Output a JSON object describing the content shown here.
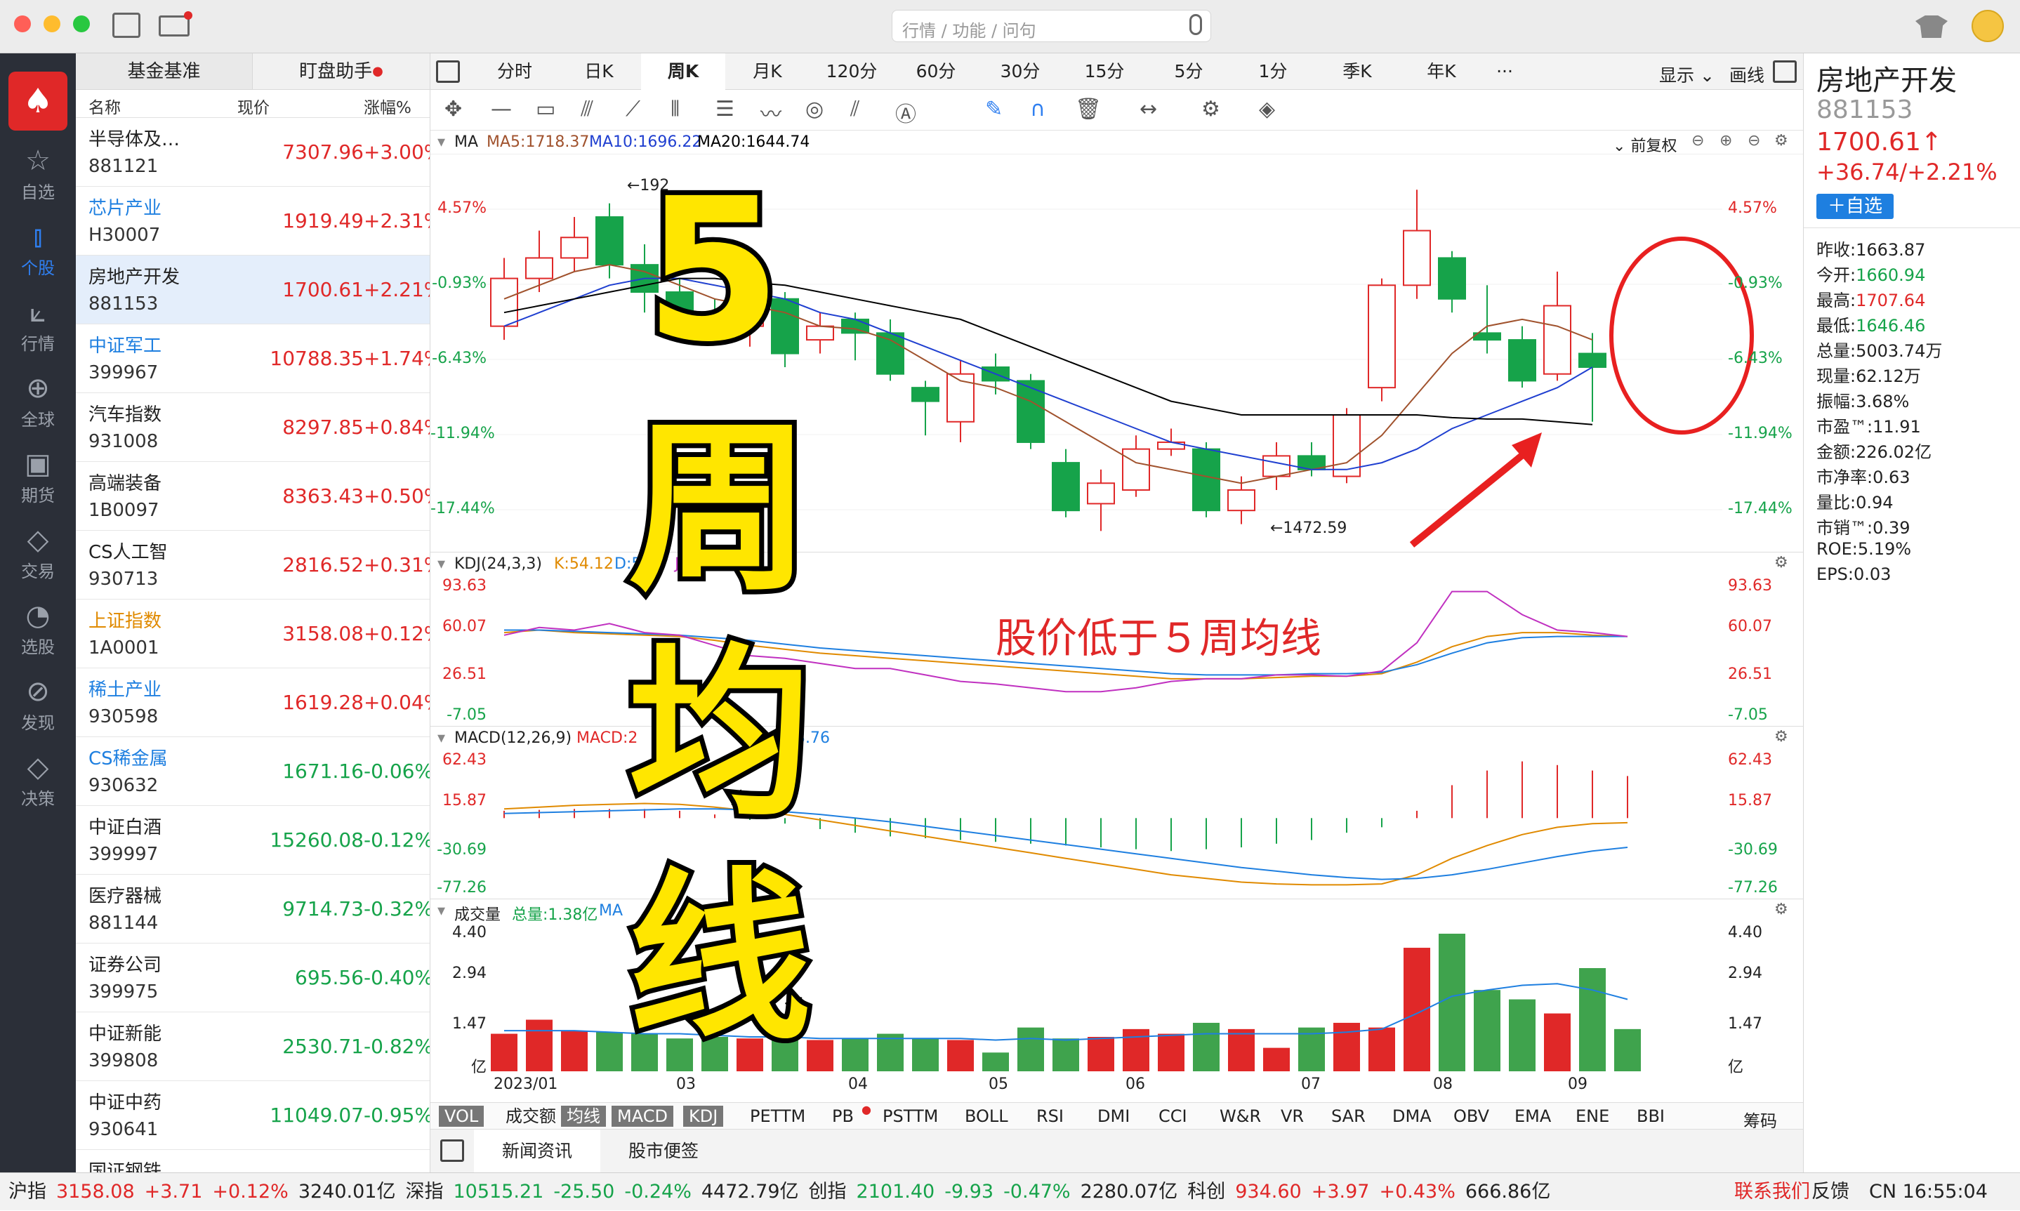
{
  "search": {
    "placeholder": "行情 / 功能 / 问句"
  },
  "nav": [
    {
      "icon": "star-icon",
      "label": "自选"
    },
    {
      "icon": "stock-icon",
      "label": "个股"
    },
    {
      "icon": "chart-icon",
      "label": "行情"
    },
    {
      "icon": "globe-icon",
      "label": "全球"
    },
    {
      "icon": "futures-icon",
      "label": "期货"
    },
    {
      "icon": "trade-icon",
      "label": "交易"
    },
    {
      "icon": "select-icon",
      "label": "选股"
    },
    {
      "icon": "compass-icon",
      "label": "发现"
    },
    {
      "icon": "diamond-icon",
      "label": "决策"
    }
  ],
  "watchlist": {
    "tabs": [
      "基金基准",
      "盯盘助手"
    ],
    "headers": [
      "名称",
      "现价",
      "涨幅%"
    ],
    "rows": [
      {
        "name": "半导体及…",
        "code": "881121",
        "price": "7307.96",
        "pct": "+3.00%",
        "up": true,
        "blue": false
      },
      {
        "name": "芯片产业",
        "code": "H30007",
        "price": "1919.49",
        "pct": "+2.31%",
        "up": true,
        "blue": true
      },
      {
        "name": "房地产开发",
        "code": "881153",
        "price": "1700.61",
        "pct": "+2.21%",
        "up": true,
        "blue": false
      },
      {
        "name": "中证军工",
        "code": "399967",
        "price": "10788.35",
        "pct": "+1.74%",
        "up": true,
        "blue": true
      },
      {
        "name": "汽车指数",
        "code": "931008",
        "price": "8297.85",
        "pct": "+0.84%",
        "up": true,
        "blue": false
      },
      {
        "name": "高端装备",
        "code": "1B0097",
        "price": "8363.43",
        "pct": "+0.50%",
        "up": true,
        "blue": false
      },
      {
        "name": "CS人工智",
        "code": "930713",
        "price": "2816.52",
        "pct": "+0.31%",
        "up": true,
        "blue": false
      },
      {
        "name": "上证指数",
        "code": "1A0001",
        "price": "3158.08",
        "pct": "+0.12%",
        "up": true,
        "blue": false,
        "orange": true
      },
      {
        "name": "稀土产业",
        "code": "930598",
        "price": "1619.28",
        "pct": "+0.04%",
        "up": true,
        "blue": true
      },
      {
        "name": "CS稀金属",
        "code": "930632",
        "price": "1671.16",
        "pct": "-0.06%",
        "up": false,
        "blue": true
      },
      {
        "name": "中证白酒",
        "code": "399997",
        "price": "15260.08",
        "pct": "-0.12%",
        "up": false,
        "blue": false
      },
      {
        "name": "医疗器械",
        "code": "881144",
        "price": "9714.73",
        "pct": "-0.32%",
        "up": false,
        "blue": false
      },
      {
        "name": "证券公司",
        "code": "399975",
        "price": "695.56",
        "pct": "-0.40%",
        "up": false,
        "blue": false
      },
      {
        "name": "中证新能",
        "code": "399808",
        "price": "2530.71",
        "pct": "-0.82%",
        "up": false,
        "blue": false
      },
      {
        "name": "中证中药",
        "code": "930641",
        "price": "11049.07",
        "pct": "-0.95%",
        "up": false,
        "blue": false
      },
      {
        "name": "国证钢铁",
        "code": "",
        "price": "",
        "pct": "",
        "up": false,
        "blue": false
      }
    ]
  },
  "periods": [
    "分时",
    "日K",
    "周K",
    "月K",
    "120分",
    "60分",
    "30分",
    "15分",
    "5分",
    "1分",
    "季K",
    "年K",
    "···"
  ],
  "display_label": "显示",
  "draw_label": "画线",
  "panels": {
    "ma": {
      "label": "MA",
      "ma5": "MA5:1718.37",
      "ma10": "MA10:1696.22",
      "ma20": "MA20:1644.74",
      "fq": "前复权",
      "axis": [
        "4.57%",
        "-0.93%",
        "-6.43%",
        "-11.94%",
        "-17.44%"
      ],
      "high_label": "←192",
      "low_label": "←1472.59"
    },
    "kdj": {
      "label": "KDJ(24,3,3)",
      "k": "K:54.12",
      "d": "D:5",
      "j": "J:56.74",
      "axis": [
        "93.63",
        "60.07",
        "26.51",
        "-7.05"
      ]
    },
    "macd": {
      "label": "MACD(12,26,9)",
      "macd": "MACD:2",
      "dea": "3.76",
      "axis": [
        "62.43",
        "15.87",
        "-30.69",
        "-77.26"
      ]
    },
    "vol": {
      "label": "成交量",
      "total": "总量:1.38亿",
      "ma": "MA",
      "axis": [
        "4.40",
        "2.94",
        "1.47",
        "亿"
      ],
      "dates": [
        "2023/01",
        "03",
        "04",
        "05",
        "06",
        "07",
        "08",
        "09"
      ]
    }
  },
  "indicators": [
    "VOL",
    "成交额",
    "均线",
    "MACD",
    "KDJ",
    "PETTM",
    "PB",
    "PSTTM",
    "BOLL",
    "RSI",
    "DMI",
    "CCI",
    "W&R",
    "VR",
    "SAR",
    "DMA",
    "OBV",
    "EMA",
    "ENE",
    "BBI"
  ],
  "chips_label": "筹码",
  "bottom_tabs": [
    "新闻资讯",
    "股市便签"
  ],
  "overlay": {
    "chars": [
      "5",
      "周",
      "均",
      "线"
    ],
    "annotation": "股价低于５周均线"
  },
  "quote": {
    "name": "房地产开发",
    "code": "881153",
    "price": "1700.61↑",
    "change": "+36.74/+2.21%",
    "add": "＋自选",
    "fields": [
      {
        "k": "昨收:",
        "v": "1663.87",
        "c": "n"
      },
      {
        "k": "今开:",
        "v": "1660.94",
        "c": "g"
      },
      {
        "k": "最高:",
        "v": "1707.64",
        "c": "r"
      },
      {
        "k": "最低:",
        "v": "1646.46",
        "c": "g"
      },
      {
        "k": "总量:",
        "v": "5003.74万",
        "c": "n"
      },
      {
        "k": "现量:",
        "v": "62.12万",
        "c": "n"
      },
      {
        "k": "振幅:",
        "v": "3.68%",
        "c": "n"
      },
      {
        "k": "市盈™:",
        "v": "11.91",
        "c": "n"
      },
      {
        "k": "金额:",
        "v": "226.02亿",
        "c": "n"
      },
      {
        "k": "市净率:",
        "v": "0.63",
        "c": "n"
      },
      {
        "k": "量比:",
        "v": "0.94",
        "c": "n"
      },
      {
        "k": "市销™:",
        "v": "0.39",
        "c": "n"
      },
      {
        "k": "ROE:",
        "v": "5.19%",
        "c": "n"
      },
      {
        "k": "EPS:",
        "v": "0.03",
        "c": "n"
      }
    ]
  },
  "status": {
    "items": [
      {
        "t": "沪指",
        "c": "n"
      },
      {
        "t": "3158.08",
        "c": "r"
      },
      {
        "t": "+3.71",
        "c": "r"
      },
      {
        "t": "+0.12%",
        "c": "r"
      },
      {
        "t": "3240.01亿",
        "c": "n"
      },
      {
        "t": "深指",
        "c": "n"
      },
      {
        "t": "10515.21",
        "c": "g"
      },
      {
        "t": "-25.50",
        "c": "g"
      },
      {
        "t": "-0.24%",
        "c": "g"
      },
      {
        "t": "4472.79亿",
        "c": "n"
      },
      {
        "t": "创指",
        "c": "n"
      },
      {
        "t": "2101.40",
        "c": "g"
      },
      {
        "t": "-9.93",
        "c": "g"
      },
      {
        "t": "-0.47%",
        "c": "g"
      },
      {
        "t": "2280.07亿",
        "c": "n"
      },
      {
        "t": "科创",
        "c": "n"
      },
      {
        "t": "934.60",
        "c": "r"
      },
      {
        "t": "+3.97",
        "c": "r"
      },
      {
        "t": "+0.43%",
        "c": "r"
      },
      {
        "t": "666.86亿",
        "c": "n"
      }
    ],
    "contact": "联系我们",
    "feedback": "反馈",
    "time": "CN 16:55:04"
  },
  "chart_data": {
    "type": "candlestick",
    "x_ticks": [
      "2023/01",
      "03",
      "04",
      "05",
      "06",
      "07",
      "08",
      "09"
    ],
    "price_axis_pct": [
      "4.57%",
      "-0.93%",
      "-6.43%",
      "-11.94%",
      "-17.44%"
    ],
    "candles": [
      {
        "o": -4,
        "c": -0.5,
        "h": 1,
        "l": -5
      },
      {
        "o": -0.5,
        "c": 1,
        "h": 3,
        "l": -1.5
      },
      {
        "o": 1,
        "c": 2.5,
        "h": 4,
        "l": 0
      },
      {
        "o": 4,
        "c": 0.5,
        "h": 5,
        "l": -0.5
      },
      {
        "o": 0.5,
        "c": -1.5,
        "h": 2,
        "l": -3
      },
      {
        "o": -1.5,
        "c": -3,
        "h": -0.5,
        "l": -4
      },
      {
        "o": -3,
        "c": -4,
        "h": -2,
        "l": -5
      },
      {
        "o": -4,
        "c": -1.5,
        "h": -0.5,
        "l": -5.5
      },
      {
        "o": -2,
        "c": -6,
        "h": -1.5,
        "l": -7
      },
      {
        "o": -5,
        "c": -4,
        "h": -3,
        "l": -6
      },
      {
        "o": -3.5,
        "c": -4.5,
        "h": -3,
        "l": -6.5
      },
      {
        "o": -4.5,
        "c": -7.5,
        "h": -3.5,
        "l": -8
      },
      {
        "o": -8.5,
        "c": -9.5,
        "h": -8,
        "l": -12
      },
      {
        "o": -11,
        "c": -7.5,
        "h": -6.5,
        "l": -12.5
      },
      {
        "o": -7,
        "c": -8,
        "h": -6,
        "l": -9
      },
      {
        "o": -8,
        "c": -12.5,
        "h": -7.5,
        "l": -13
      },
      {
        "o": -14,
        "c": -17.5,
        "h": -13,
        "l": -18
      },
      {
        "o": -17,
        "c": -15.5,
        "h": -14.5,
        "l": -19
      },
      {
        "o": -16,
        "c": -13,
        "h": -12,
        "l": -16.5
      },
      {
        "o": -13,
        "c": -12.5,
        "h": -11.5,
        "l": -13.5
      },
      {
        "o": -13,
        "c": -17.5,
        "h": -12.5,
        "l": -18
      },
      {
        "o": -17.5,
        "c": -16,
        "h": -15,
        "l": -18.5
      },
      {
        "o": -15,
        "c": -13.5,
        "h": -12.5,
        "l": -16
      },
      {
        "o": -13.5,
        "c": -14.5,
        "h": -12.5,
        "l": -15
      },
      {
        "o": -15,
        "c": -10.5,
        "h": -10,
        "l": -15.5
      },
      {
        "o": -8.5,
        "c": -1,
        "h": -0.5,
        "l": -9.5
      },
      {
        "o": -1,
        "c": 3,
        "h": 6,
        "l": -2
      },
      {
        "o": 1,
        "c": -2,
        "h": 1.5,
        "l": -3
      },
      {
        "o": -4.5,
        "c": -5,
        "h": -1,
        "l": -6
      },
      {
        "o": -5,
        "c": -8,
        "h": -4,
        "l": -8.5
      },
      {
        "o": -7.5,
        "c": -2.5,
        "h": 0,
        "l": -8
      },
      {
        "o": -6,
        "c": -7,
        "h": -4.5,
        "l": -11
      }
    ],
    "ma5": [
      -2,
      -1,
      0,
      0.5,
      0,
      -1,
      -2,
      -2.5,
      -3,
      -4,
      -4.2,
      -5,
      -6.5,
      -8,
      -8.5,
      -9.5,
      -11,
      -12.5,
      -14,
      -14.5,
      -15,
      -15.5,
      -15,
      -14.5,
      -14,
      -12,
      -9,
      -6,
      -4,
      -3.5,
      -4,
      -5
    ],
    "ma10": [
      -4,
      -3,
      -2,
      -1,
      -0.5,
      -0.5,
      -1,
      -1.5,
      -2,
      -3,
      -3.5,
      -4.5,
      -5.5,
      -6.5,
      -7.5,
      -8.5,
      -9.5,
      -10.5,
      -11.5,
      -12.5,
      -13,
      -13.5,
      -14,
      -14.5,
      -14.5,
      -14,
      -13,
      -11.5,
      -10.5,
      -9.5,
      -8.5,
      -7
    ],
    "ma20": [
      -3,
      -2.5,
      -2,
      -1.5,
      -1,
      -0.5,
      -0.5,
      -0.8,
      -1,
      -1.5,
      -2,
      -2.5,
      -3,
      -3.5,
      -4.5,
      -5.5,
      -6.5,
      -7.5,
      -8.5,
      -9.5,
      -10,
      -10.5,
      -10.5,
      -10.5,
      -10.5,
      -10.5,
      -10.5,
      -10.7,
      -10.8,
      -10.8,
      -11,
      -11.2
    ],
    "volume": [
      1.2,
      1.65,
      1.3,
      1.25,
      1.2,
      1.05,
      1.1,
      1.05,
      1.1,
      1.0,
      1.05,
      1.2,
      1.05,
      1.0,
      0.6,
      1.4,
      1.05,
      1.1,
      1.35,
      1.2,
      1.55,
      1.35,
      0.75,
      1.4,
      1.55,
      1.4,
      3.95,
      4.4,
      2.6,
      2.3,
      1.85,
      3.3,
      1.35
    ],
    "vol_ma": [
      1.3,
      1.3,
      1.3,
      1.25,
      1.2,
      1.2,
      1.15,
      1.1,
      1.1,
      1.05,
      1.05,
      1.05,
      1.05,
      1.05,
      1.0,
      1.05,
      1.0,
      1.05,
      1.1,
      1.15,
      1.2,
      1.2,
      1.2,
      1.2,
      1.25,
      1.35,
      1.85,
      2.4,
      2.6,
      2.75,
      2.8,
      2.6,
      2.3
    ],
    "kdj_k": [
      58,
      60,
      58,
      57,
      56,
      55,
      52,
      48,
      45,
      42,
      40,
      38,
      36,
      34,
      32,
      30,
      28,
      26,
      24,
      22,
      22,
      22,
      23,
      24,
      24,
      26,
      35,
      47,
      55,
      58,
      58,
      56,
      55
    ],
    "kdj_d": [
      60,
      60,
      59,
      58,
      57,
      56,
      54,
      52,
      49,
      46,
      44,
      42,
      40,
      38,
      36,
      34,
      32,
      30,
      28,
      26,
      25,
      25,
      25,
      26,
      26,
      27,
      33,
      42,
      50,
      54,
      55,
      55,
      55
    ],
    "kdj_j": [
      56,
      62,
      60,
      65,
      58,
      56,
      48,
      40,
      38,
      34,
      30,
      30,
      25,
      20,
      18,
      15,
      12,
      12,
      15,
      20,
      22,
      22,
      25,
      25,
      24,
      28,
      50,
      90,
      90,
      72,
      60,
      58,
      55
    ],
    "macd_dif": [
      10,
      12,
      14,
      15,
      16,
      15,
      12,
      8,
      4,
      -2,
      -8,
      -14,
      -20,
      -26,
      -32,
      -38,
      -44,
      -50,
      -56,
      -62,
      -66,
      -70,
      -72,
      -73,
      -73,
      -72,
      -62,
      -44,
      -30,
      -18,
      -10,
      -6,
      -5
    ],
    "macd_dea": [
      5,
      6,
      7,
      8,
      9,
      10,
      10,
      9,
      7,
      4,
      0,
      -4,
      -9,
      -14,
      -19,
      -24,
      -29,
      -34,
      -39,
      -44,
      -49,
      -54,
      -58,
      -62,
      -65,
      -67,
      -66,
      -62,
      -56,
      -49,
      -42,
      -36,
      -32
    ],
    "macd_hist": [
      8,
      9,
      10,
      10,
      10,
      8,
      4,
      -2,
      -6,
      -12,
      -16,
      -20,
      -22,
      -24,
      -26,
      -28,
      -30,
      -32,
      -34,
      -36,
      -34,
      -32,
      -28,
      -24,
      -16,
      -10,
      8,
      36,
      52,
      62,
      58,
      52,
      46
    ]
  }
}
